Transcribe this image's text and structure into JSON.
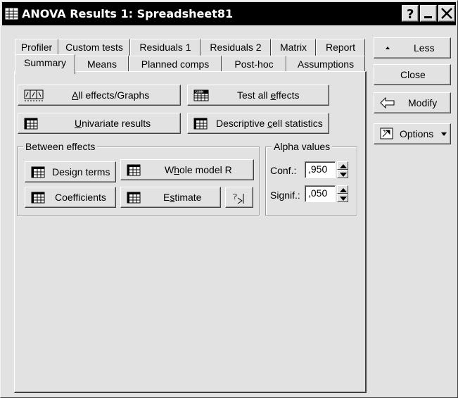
{
  "window": {
    "title": "ANOVA Results 1: Spreadsheet81"
  },
  "titlebar_buttons": {
    "help": "?",
    "minimize": "_",
    "close": "X"
  },
  "tabs_back": [
    "Profiler",
    "Custom tests",
    "Residuals 1",
    "Residuals 2",
    "Matrix",
    "Report"
  ],
  "tabs_front": [
    "Summary",
    "Means",
    "Planned comps",
    "Post-hoc",
    "Assumptions"
  ],
  "active_tab": "Summary",
  "buttons": {
    "all_effects": {
      "pre": "",
      "u": "A",
      "post": "ll effects/Graphs"
    },
    "test_all": {
      "pre": "Test all ",
      "u": "e",
      "post": "ffects"
    },
    "univariate": {
      "pre": "",
      "u": "U",
      "post": "nivariate results"
    },
    "descriptive": {
      "pre": "Descriptive ",
      "u": "c",
      "post": "ell statistics"
    }
  },
  "between_effects": {
    "title": "Between effects",
    "design_terms": "Design terms",
    "whole_model": {
      "pre": "W",
      "u": "h",
      "post": "ole model R"
    },
    "coefficients": "Coefficients",
    "estimate": {
      "pre": "E",
      "u": "s",
      "post": "timate"
    }
  },
  "alpha": {
    "title": "Alpha values",
    "conf_label": "Conf.:",
    "conf_value": ",950",
    "signif_label": "Signif.:",
    "signif_value": ",050"
  },
  "side": {
    "less": "Less",
    "close": "Close",
    "modify": "Modify",
    "options": "Options"
  },
  "icons": {
    "app": "spreadsheet-icon",
    "graphs": "graph-icon",
    "sums": "sum-table-icon",
    "table": "table-icon",
    "formula": "formula-icon"
  }
}
